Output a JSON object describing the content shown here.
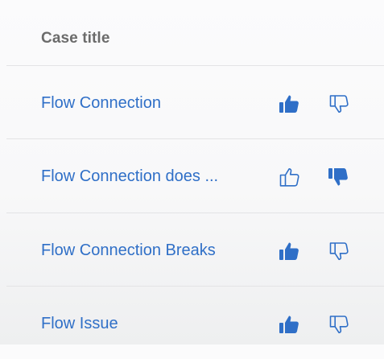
{
  "table": {
    "header_title": "Case title",
    "rows": [
      {
        "title": "Flow Connection",
        "thumbs_up_icon": "thumbs-up-filled",
        "thumbs_down_icon": "thumbs-down-outline"
      },
      {
        "title": "Flow Connection does ...",
        "thumbs_up_icon": "thumbs-up-outline",
        "thumbs_down_icon": "thumbs-down-filled"
      },
      {
        "title": "Flow Connection Breaks",
        "thumbs_up_icon": "thumbs-up-filled",
        "thumbs_down_icon": "thumbs-down-outline"
      },
      {
        "title": "Flow Issue",
        "thumbs_up_icon": "thumbs-up-filled",
        "thumbs_down_icon": "thumbs-down-outline"
      }
    ]
  },
  "colors": {
    "accent": "#2f6fc7",
    "header_text": "#6b6b6b",
    "divider": "#e3e3e5"
  }
}
